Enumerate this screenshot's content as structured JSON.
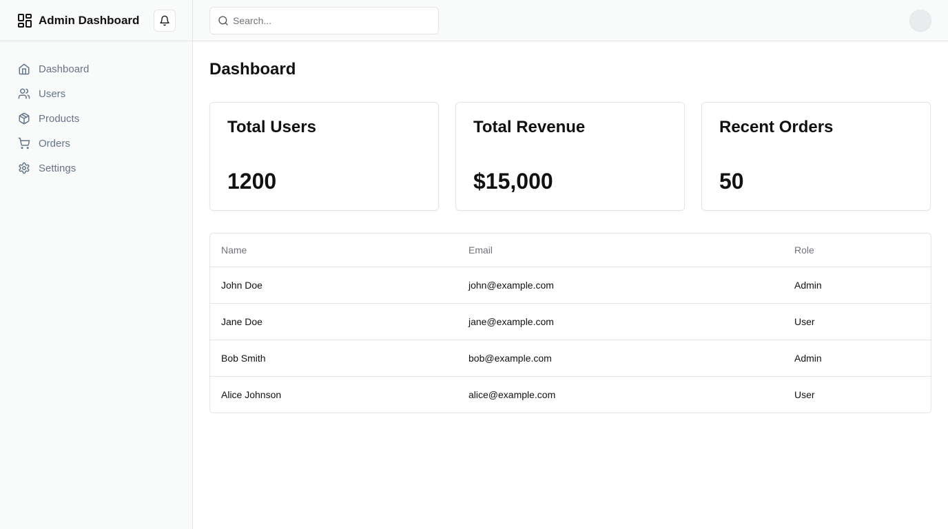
{
  "brand": {
    "title": "Admin Dashboard"
  },
  "sidebar": {
    "items": [
      {
        "label": "Dashboard",
        "icon": "home-icon"
      },
      {
        "label": "Users",
        "icon": "users-icon"
      },
      {
        "label": "Products",
        "icon": "package-icon"
      },
      {
        "label": "Orders",
        "icon": "shopping-cart-icon"
      },
      {
        "label": "Settings",
        "icon": "gear-icon"
      }
    ]
  },
  "header": {
    "search": {
      "placeholder": "Search...",
      "value": ""
    }
  },
  "main": {
    "title": "Dashboard",
    "cards": [
      {
        "title": "Total Users",
        "value": "1200"
      },
      {
        "title": "Total Revenue",
        "value": "$15,000"
      },
      {
        "title": "Recent Orders",
        "value": "50"
      }
    ],
    "table": {
      "columns": [
        "Name",
        "Email",
        "Role"
      ],
      "rows": [
        [
          "John Doe",
          "john@example.com",
          "Admin"
        ],
        [
          "Jane Doe",
          "jane@example.com",
          "User"
        ],
        [
          "Bob Smith",
          "bob@example.com",
          "Admin"
        ],
        [
          "Alice Johnson",
          "alice@example.com",
          "User"
        ]
      ]
    }
  },
  "colors": {
    "sidebar_bg": "#f9fafa",
    "border": "#e4e4e7",
    "muted_text": "#64748b",
    "text": "#111111"
  }
}
